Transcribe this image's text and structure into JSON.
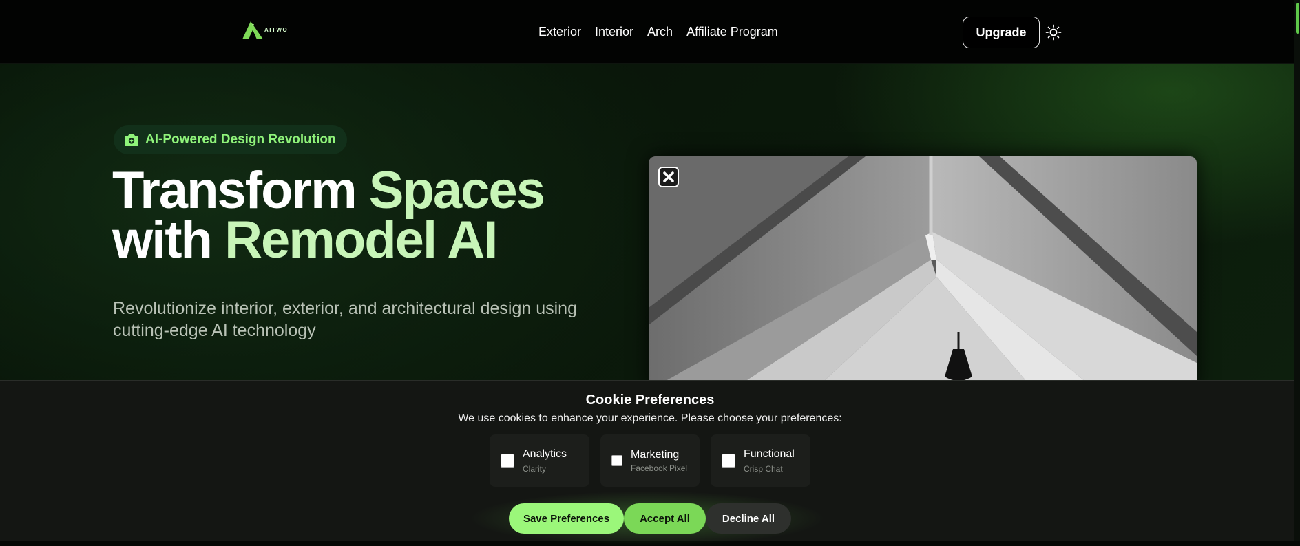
{
  "header": {
    "logo_text": "AITWO",
    "nav": [
      "Exterior",
      "Interior",
      "Arch",
      "Affiliate Program"
    ],
    "upgrade_label": "Upgrade",
    "theme_icon": "sun-icon"
  },
  "hero": {
    "badge_icon": "magic-image-icon",
    "badge_label": "AI-Powered Design Revolution",
    "headline_line1_white": "Transform",
    "headline_line1_green": "Spaces",
    "headline_line2_white": "with",
    "headline_line2_green": "Remodel AI",
    "subtitle_line1": "Revolutionize interior, exterior, and architectural design using",
    "subtitle_line2": "cutting-edge AI technology",
    "media_close_icon": "close-icon"
  },
  "cookie": {
    "title": "Cookie Preferences",
    "description": "We use cookies to enhance your experience. Please choose your preferences:",
    "options": [
      {
        "label": "Analytics",
        "provider": "Clarity",
        "checked": false
      },
      {
        "label": "Marketing",
        "provider": "Facebook Pixel",
        "checked": false
      },
      {
        "label": "Functional",
        "provider": "Crisp Chat",
        "checked": false
      }
    ],
    "save_label": "Save Preferences",
    "accept_label": "Accept All",
    "decline_label": "Decline All"
  },
  "colors": {
    "accent": "#9bf77a",
    "accent_dark": "#7bd857",
    "headline_green": "#c8f5b8",
    "badge_text": "#8ff37a",
    "background": "#050805"
  }
}
